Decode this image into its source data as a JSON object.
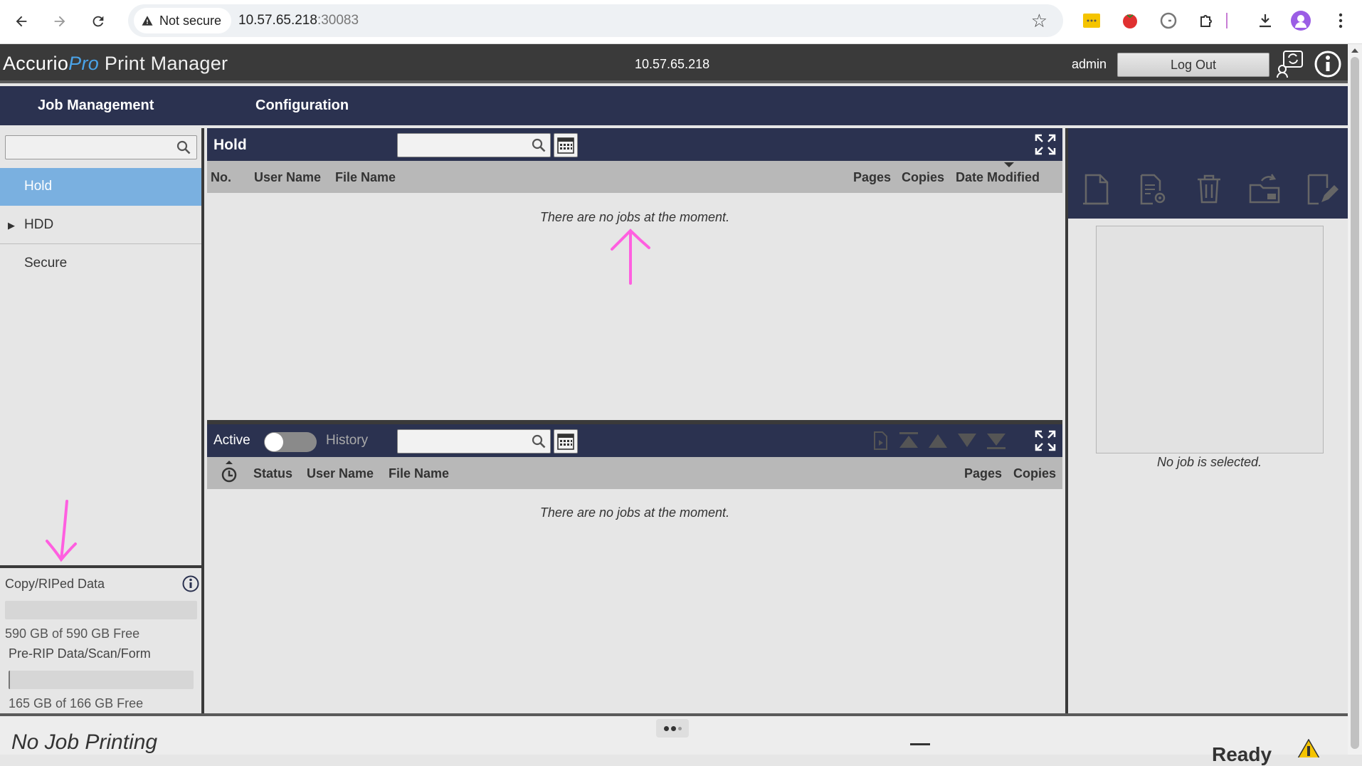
{
  "browser": {
    "security_label": "Not secure",
    "url_host": "10.57.65.218",
    "url_port": ":30083"
  },
  "header": {
    "logo_accurio": "Accurio",
    "logo_pro": "Pro",
    "logo_product": " Print Manager",
    "host_ip": "10.57.65.218",
    "user": "admin",
    "logout_label": "Log Out"
  },
  "nav": {
    "items": [
      {
        "label": "Job Management"
      },
      {
        "label": "Configuration"
      }
    ]
  },
  "sidebar": {
    "search": {
      "value": "",
      "placeholder": ""
    },
    "items": [
      {
        "label": "Hold",
        "active": true
      },
      {
        "label": "HDD",
        "expandable": true
      },
      {
        "label": "Secure"
      }
    ],
    "storage": [
      {
        "title": "Copy/RIPed Data",
        "free_text": "590 GB of 590 GB Free",
        "used_fraction": 0.0
      },
      {
        "title": "Pre-RIP Data/Scan/Form",
        "free_text": "165 GB of 166 GB Free",
        "used_fraction": 0.006
      }
    ]
  },
  "hold_panel": {
    "title": "Hold",
    "search": {
      "value": "",
      "placeholder": ""
    },
    "columns": [
      "No.",
      "User Name",
      "File Name",
      "Pages",
      "Copies",
      "Date Modified"
    ],
    "sorted_column": "Date Modified",
    "empty_message": "There are no jobs at the moment."
  },
  "active_panel": {
    "active_label": "Active",
    "history_label": "History",
    "toggle_on": false,
    "search": {
      "value": "",
      "placeholder": ""
    },
    "columns": [
      "Status",
      "User Name",
      "File Name",
      "Pages",
      "Copies"
    ],
    "empty_message": "There are no jobs at the moment."
  },
  "detail_panel": {
    "toolbar_icons": [
      "document-icon",
      "document-settings-icon",
      "trash-icon",
      "move-to-folder-icon",
      "edit-document-icon"
    ],
    "no_selection": "No job is selected."
  },
  "status_bar": {
    "printing_status": "No Job Printing",
    "machine_status": "Ready"
  },
  "colors": {
    "nav_bg": "#2b3250",
    "header_bg": "#3a3a3a",
    "active_item": "#7ab0e0",
    "annotation": "#ff5fe0"
  }
}
